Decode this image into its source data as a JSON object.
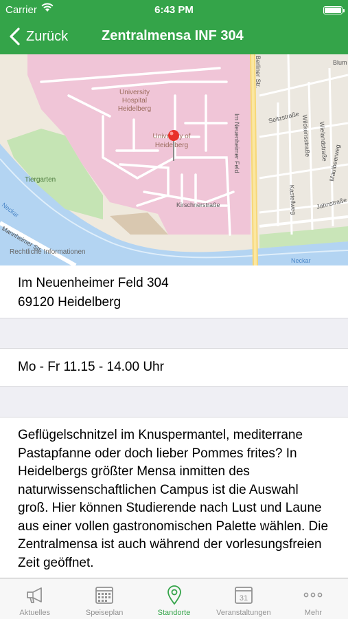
{
  "status_bar": {
    "carrier": "Carrier",
    "time": "6:43 PM"
  },
  "nav": {
    "back_label": "Zurück",
    "title": "Zentralmensa INF 304"
  },
  "map": {
    "labels": {
      "hospital_line1": "University",
      "hospital_line2": "Hospital",
      "hospital_line3": "Heidelberg",
      "university_line1": "University of",
      "university_line2": "Heidelberg",
      "tiergarten": "Tiergarten",
      "neckar_left": "Neckar",
      "neckar_right": "Neckar",
      "mannheimer": "Mannheimer Str.",
      "berliner": "Berliner Str.",
      "im_neuenheimer": "Im Neuenheimer Feld",
      "kirschner": "Kirschnerstraße",
      "seitz": "Seitzstraße",
      "wilckens": "Wilckensstraße",
      "wieland": "Wielandstraße",
      "maulbeer": "Maulbeerweg",
      "jahn": "Jahnstraße",
      "kastell": "Kastellweg",
      "blum": "Blum"
    },
    "legal_text": "Rechtliche Informationen"
  },
  "location": {
    "address_line1": "Im Neuenheimer Feld 304",
    "address_line2": "69120 Heidelberg",
    "opening_hours": "Mo - Fr 11.15 - 14.00 Uhr",
    "description": "Geflügelschnitzel im Knuspermantel, mediterrane Pastapfanne oder doch lieber Pommes frites? In Heidelbergs größter Mensa inmitten des naturwissenschaftlichen Campus ist die Auswahl groß. Hier können Studierende nach Lust und Laune aus einer vollen gastronomischen Palette wählen. Die Zentralmensa ist auch während der vorlesungsfreien Zeit geöffnet."
  },
  "tabs": [
    {
      "label": "Aktuelles",
      "icon": "megaphone-icon"
    },
    {
      "label": "Speiseplan",
      "icon": "calendar-grid-icon"
    },
    {
      "label": "Standorte",
      "icon": "location-pin-icon"
    },
    {
      "label": "Veranstaltungen",
      "icon": "calendar-31-icon",
      "icon_text": "31"
    },
    {
      "label": "Mehr",
      "icon": "more-dots-icon"
    }
  ],
  "active_tab": "Standorte",
  "colors": {
    "accent": "#34a449",
    "tab_inactive": "#929292",
    "campus": "#f0c5d7",
    "water": "#b3d4f2",
    "park": "#c5e4b4"
  }
}
